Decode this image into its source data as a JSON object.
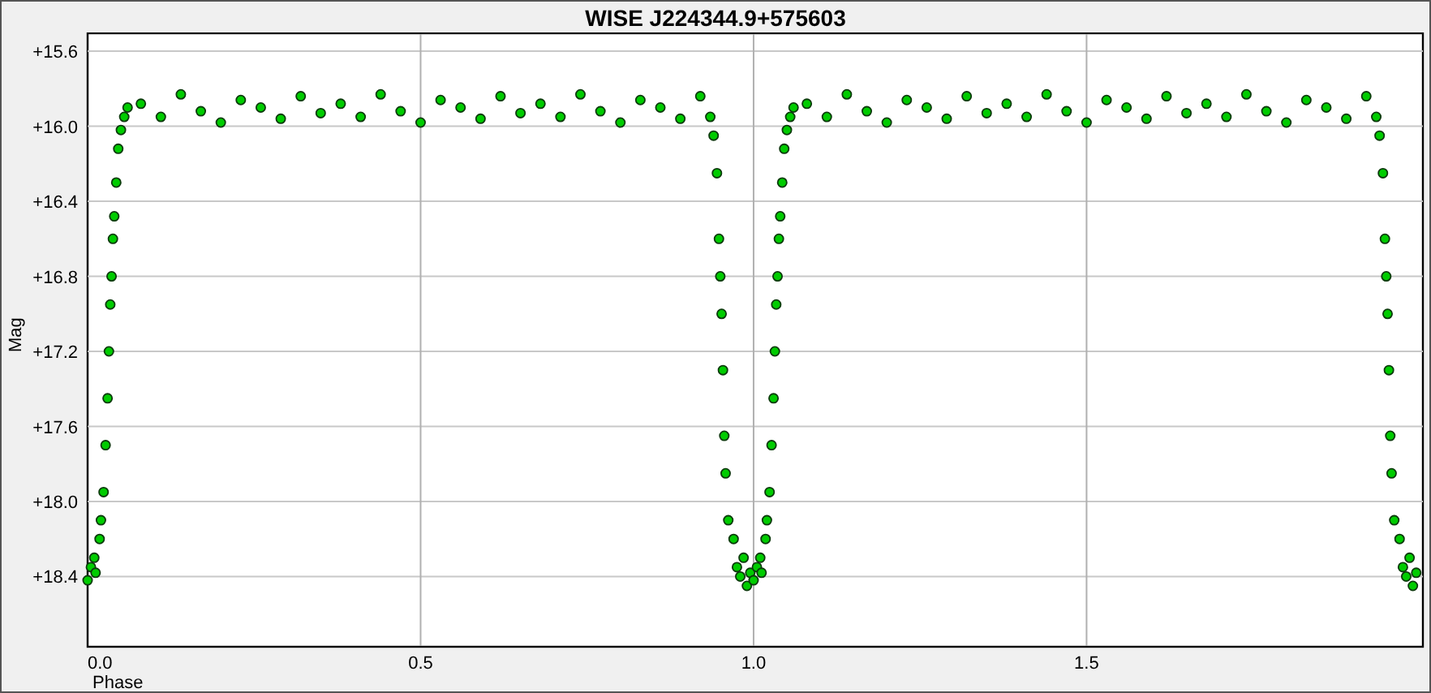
{
  "chart": {
    "chart_data": {
      "type": "scatter",
      "title": "WISE J224344.9+575603",
      "xlabel": "Phase",
      "ylabel": "Mag",
      "xlim": [
        0,
        2.005
      ],
      "ylim": [
        18.77,
        15.5
      ],
      "xticks": [
        {
          "value": 0,
          "label": "0.0"
        },
        {
          "value": 0.5,
          "label": "0.5"
        },
        {
          "value": 1,
          "label": "1.0"
        },
        {
          "value": 1.5,
          "label": "1.5"
        }
      ],
      "yticks": [
        {
          "value": 15.6,
          "label": "+15.6"
        },
        {
          "value": 16.0,
          "label": "+16.0"
        },
        {
          "value": 16.4,
          "label": "+16.4"
        },
        {
          "value": 16.8,
          "label": "+16.8"
        },
        {
          "value": 17.2,
          "label": "+17.2"
        },
        {
          "value": 17.6,
          "label": "+17.6"
        },
        {
          "value": 18.0,
          "label": "+18.0"
        },
        {
          "value": 18.4,
          "label": "+18.4"
        }
      ],
      "x": [
        0.0,
        0.005,
        0.01,
        0.012,
        0.018,
        0.02,
        0.024,
        0.027,
        0.03,
        0.032,
        0.034,
        0.036,
        0.038,
        0.04,
        0.043,
        0.046,
        0.05,
        0.055,
        0.06,
        0.08,
        0.11,
        0.14,
        0.17,
        0.2,
        0.23,
        0.26,
        0.29,
        0.32,
        0.35,
        0.38,
        0.41,
        0.44,
        0.47,
        0.5,
        0.53,
        0.56,
        0.59,
        0.62,
        0.65,
        0.68,
        0.71,
        0.74,
        0.77,
        0.8,
        0.83,
        0.86,
        0.89,
        0.92,
        0.935,
        0.94,
        0.945,
        0.948,
        0.95,
        0.952,
        0.954,
        0.956,
        0.958,
        0.962,
        0.97,
        0.975,
        0.98,
        0.985,
        0.99,
        0.995,
        1.0,
        1.005,
        1.01,
        1.012,
        1.018,
        1.02,
        1.024,
        1.027,
        1.03,
        1.032,
        1.034,
        1.036,
        1.038,
        1.04,
        1.043,
        1.046,
        1.05,
        1.055,
        1.06,
        1.08,
        1.11,
        1.14,
        1.17,
        1.2,
        1.23,
        1.26,
        1.29,
        1.32,
        1.35,
        1.38,
        1.41,
        1.44,
        1.47,
        1.5,
        1.53,
        1.56,
        1.59,
        1.62,
        1.65,
        1.68,
        1.71,
        1.74,
        1.77,
        1.8,
        1.83,
        1.86,
        1.89,
        1.92,
        1.935,
        1.94,
        1.945,
        1.948,
        1.95,
        1.952,
        1.954,
        1.956,
        1.958,
        1.962,
        1.97,
        1.975,
        1.98,
        1.985,
        1.99,
        1.995
      ],
      "grid": true,
      "series": [
        {
          "color": "#00cc00",
          "values": [
            18.42,
            18.35,
            18.3,
            18.38,
            18.2,
            18.1,
            17.95,
            17.7,
            17.45,
            17.2,
            16.95,
            16.8,
            16.6,
            16.48,
            16.3,
            16.12,
            16.02,
            15.95,
            15.9,
            15.88,
            15.95,
            15.83,
            15.92,
            15.98,
            15.86,
            15.9,
            15.96,
            15.84,
            15.93,
            15.88,
            15.95,
            15.83,
            15.92,
            15.98,
            15.86,
            15.9,
            15.96,
            15.84,
            15.93,
            15.88,
            15.95,
            15.83,
            15.92,
            15.98,
            15.86,
            15.9,
            15.96,
            15.84,
            15.95,
            16.05,
            16.25,
            16.6,
            16.8,
            17.0,
            17.3,
            17.65,
            17.85,
            18.1,
            18.2,
            18.35,
            18.4,
            18.3,
            18.45,
            18.38,
            18.42,
            18.35,
            18.3,
            18.38,
            18.2,
            18.1,
            17.95,
            17.7,
            17.45,
            17.2,
            16.95,
            16.8,
            16.6,
            16.48,
            16.3,
            16.12,
            16.02,
            15.95,
            15.9,
            15.88,
            15.95,
            15.83,
            15.92,
            15.98,
            15.86,
            15.9,
            15.96,
            15.84,
            15.93,
            15.88,
            15.95,
            15.83,
            15.92,
            15.98,
            15.86,
            15.9,
            15.96,
            15.84,
            15.93,
            15.88,
            15.95,
            15.83,
            15.92,
            15.98,
            15.86,
            15.9,
            15.96,
            15.84,
            15.95,
            16.05,
            16.25,
            16.6,
            16.8,
            17.0,
            17.3,
            17.65,
            17.85,
            18.1,
            18.2,
            18.35,
            18.4,
            18.3,
            18.45,
            18.38
          ]
        }
      ]
    }
  }
}
